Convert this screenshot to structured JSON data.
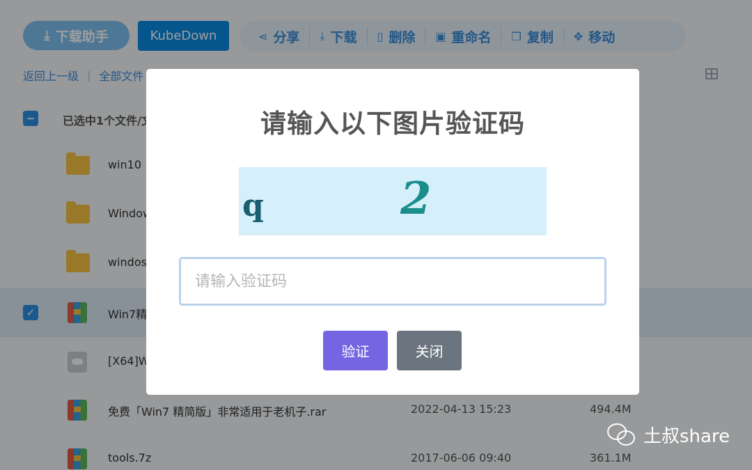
{
  "toolbar": {
    "helper_label": "下载助手",
    "kube_label": "KubeDown",
    "actions": [
      {
        "label": "分享",
        "icon": "share-icon"
      },
      {
        "label": "下载",
        "icon": "download-icon"
      },
      {
        "label": "删除",
        "icon": "trash-icon"
      },
      {
        "label": "重命名",
        "icon": "rename-icon"
      },
      {
        "label": "复制",
        "icon": "copy-icon"
      },
      {
        "label": "移动",
        "icon": "move-icon"
      }
    ]
  },
  "breadcrumb": {
    "back": "返回上一级",
    "all": "全部文件"
  },
  "selection": {
    "text": "已选中1个文件/文"
  },
  "files": [
    {
      "name": "win10",
      "type": "folder",
      "date": "",
      "size": ""
    },
    {
      "name": "Window",
      "type": "folder",
      "date": "",
      "size": ""
    },
    {
      "name": "windos",
      "type": "folder",
      "date": "",
      "size": ""
    },
    {
      "name": "Win7精",
      "type": "archive",
      "date": "",
      "size": "",
      "selected": true
    },
    {
      "name": "[X64]W",
      "type": "cloud",
      "date": "",
      "size": ""
    },
    {
      "name": "免费「Win7 精简版」非常适用于老机子.rar",
      "type": "archive",
      "date": "2022-04-13 15:23",
      "size": "494.4M"
    },
    {
      "name": "tools.7z",
      "type": "archive",
      "date": "2017-06-06 09:40",
      "size": "361.1M"
    }
  ],
  "dialog": {
    "title": "请输入以下图片验证码",
    "captcha_chars": [
      "q",
      "2"
    ],
    "input_value": "",
    "input_placeholder": "请输入验证码",
    "verify_label": "验证",
    "close_label": "关闭"
  },
  "watermark": {
    "text": "土叔share"
  },
  "colors": {
    "primary": "#0b8be6",
    "helper": "#7ec0f0",
    "action_text": "#3b8fd9",
    "verify": "#7565e3",
    "close": "#6b757f",
    "captcha_bg": "#d5f0fa"
  }
}
